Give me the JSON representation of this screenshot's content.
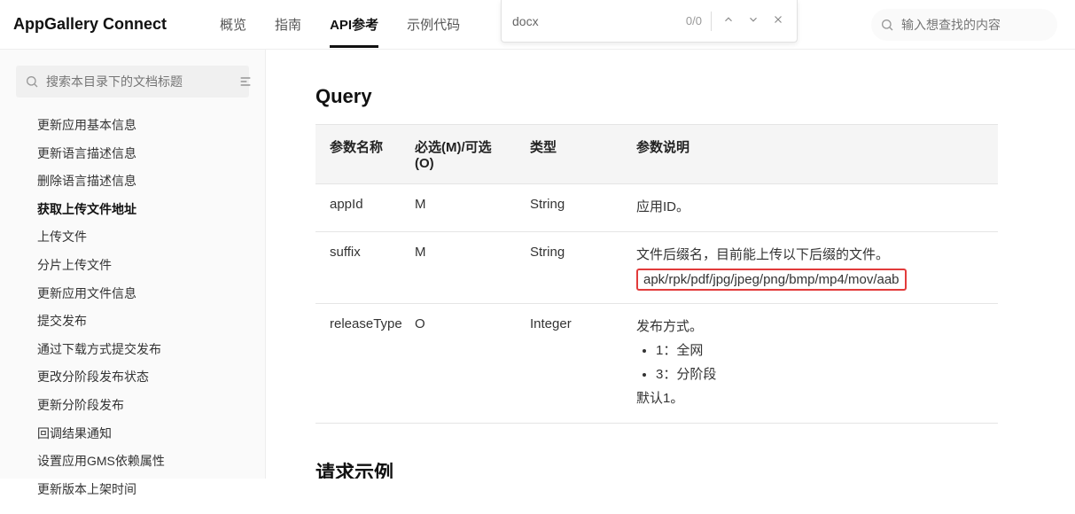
{
  "header": {
    "brand": "AppGallery Connect",
    "tabs": [
      {
        "label": "概览",
        "active": false
      },
      {
        "label": "指南",
        "active": false
      },
      {
        "label": "API参考",
        "active": true
      },
      {
        "label": "示例代码",
        "active": false
      }
    ]
  },
  "find_bar": {
    "query": "docx",
    "count": "0/0"
  },
  "global_search": {
    "placeholder": "输入想查找的内容"
  },
  "sidebar": {
    "search_placeholder": "搜索本目录下的文档标题",
    "items": [
      {
        "label": "更新应用基本信息",
        "active": false
      },
      {
        "label": "更新语言描述信息",
        "active": false
      },
      {
        "label": "删除语言描述信息",
        "active": false
      },
      {
        "label": "获取上传文件地址",
        "active": true
      },
      {
        "label": "上传文件",
        "active": false
      },
      {
        "label": "分片上传文件",
        "active": false
      },
      {
        "label": "更新应用文件信息",
        "active": false
      },
      {
        "label": "提交发布",
        "active": false
      },
      {
        "label": "通过下载方式提交发布",
        "active": false
      },
      {
        "label": "更改分阶段发布状态",
        "active": false
      },
      {
        "label": "更新分阶段发布",
        "active": false
      },
      {
        "label": "回调结果通知",
        "active": false
      },
      {
        "label": "设置应用GMS依赖属性",
        "active": false
      },
      {
        "label": "更新版本上架时间",
        "active": false
      }
    ]
  },
  "content": {
    "section_title": "Query",
    "table": {
      "headers": {
        "name": "参数名称",
        "required": "必选(M)/可选(O)",
        "type": "类型",
        "desc": "参数说明"
      },
      "rows": [
        {
          "name": "appId",
          "required": "M",
          "type": "String",
          "desc_lines": [
            "应用ID。"
          ],
          "highlight": null,
          "list": [],
          "tail": null
        },
        {
          "name": "suffix",
          "required": "M",
          "type": "String",
          "desc_lines": [
            "文件后缀名，目前能上传以下后缀的文件。"
          ],
          "highlight": "apk/rpk/pdf/jpg/jpeg/png/bmp/mp4/mov/aab",
          "list": [],
          "tail": null
        },
        {
          "name": "releaseType",
          "required": "O",
          "type": "Integer",
          "desc_lines": [
            "发布方式。"
          ],
          "highlight": null,
          "list": [
            "1：全网",
            "3：分阶段"
          ],
          "tail": "默认1。"
        }
      ]
    },
    "example_title": "请求示例"
  }
}
